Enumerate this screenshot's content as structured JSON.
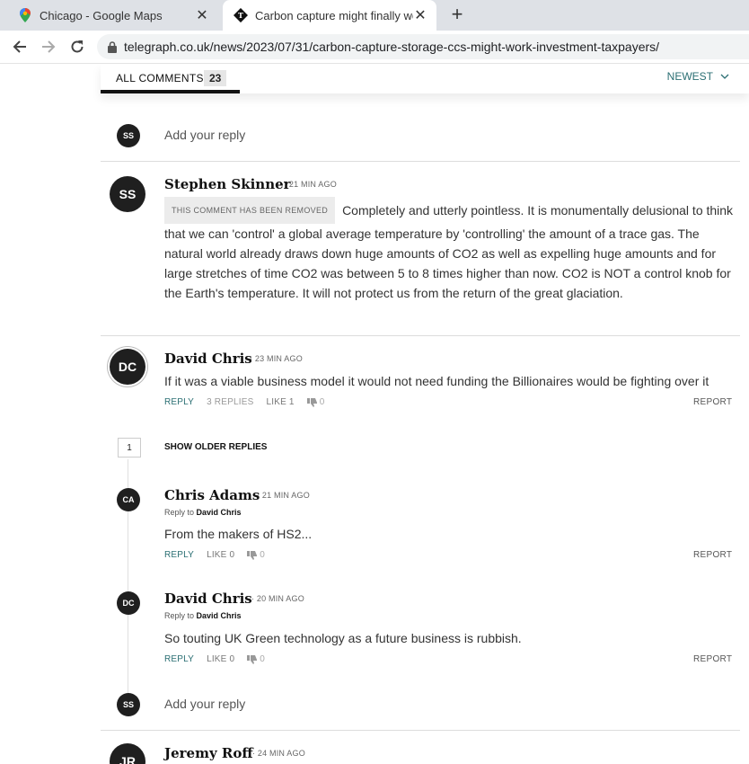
{
  "browser": {
    "tabs": [
      {
        "title": "Chicago - Google Maps",
        "icon": "google-maps-icon"
      },
      {
        "title": "Carbon capture might finally wor",
        "icon": "telegraph-icon"
      }
    ],
    "url": "telegraph.co.uk/news/2023/07/31/carbon-capture-storage-ccs-might-work-investment-taxpayers/"
  },
  "comments_bar": {
    "tab_label": "ALL COMMENTS",
    "count": "23",
    "sort_label": "NEWEST"
  },
  "reply_placeholder": "Add your reply",
  "avatars": {
    "ss": "SS",
    "dc": "DC",
    "ca": "CA",
    "jr": "JR"
  },
  "comments": [
    {
      "author": "Stephen Skinner",
      "time": "· 21 MIN AGO",
      "removed_badge": "THIS COMMENT HAS BEEN REMOVED",
      "text": "Completely and utterly pointless. It is monumentally delusional to think that we can 'control' a global average temperature by 'controlling' the amount of a trace gas. The natural world already draws down huge amounts of CO2 as well as expelling huge amounts and for large stretches of time CO2 was between 5 to 8 times higher than now. CO2 is NOT a control knob for the Earth's temperature. It will not protect us from the return of the great glaciation."
    },
    {
      "author": "David Chris",
      "time": "· 23 MIN AGO",
      "text": "If it was a viable business model it would not need funding the Billionaires would be fighting over it",
      "reply": "REPLY",
      "replies": "3 REPLIES",
      "likes": "LIKE 1",
      "dislikes": "0",
      "report": "REPORT"
    }
  ],
  "older_replies": {
    "count": "1",
    "label": "SHOW OLDER REPLIES"
  },
  "replies": [
    {
      "author": "Chris Adams",
      "time": "· 21 MIN AGO",
      "reply_to_prefix": "Reply to",
      "reply_to": "David Chris",
      "text": "From the makers of HS2...",
      "reply": "REPLY",
      "likes": "LIKE 0",
      "dislikes": "0",
      "report": "REPORT"
    },
    {
      "author": "David Chris",
      "time": "· 20 MIN AGO",
      "reply_to_prefix": "Reply to",
      "reply_to": "David Chris",
      "text": "So touting UK Green technology as a future business is rubbish.",
      "reply": "REPLY",
      "likes": "LIKE 0",
      "dislikes": "0",
      "report": "REPORT"
    }
  ],
  "next_comment": {
    "author": "Jeremy Roff",
    "time": "· 24 MIN AGO"
  }
}
